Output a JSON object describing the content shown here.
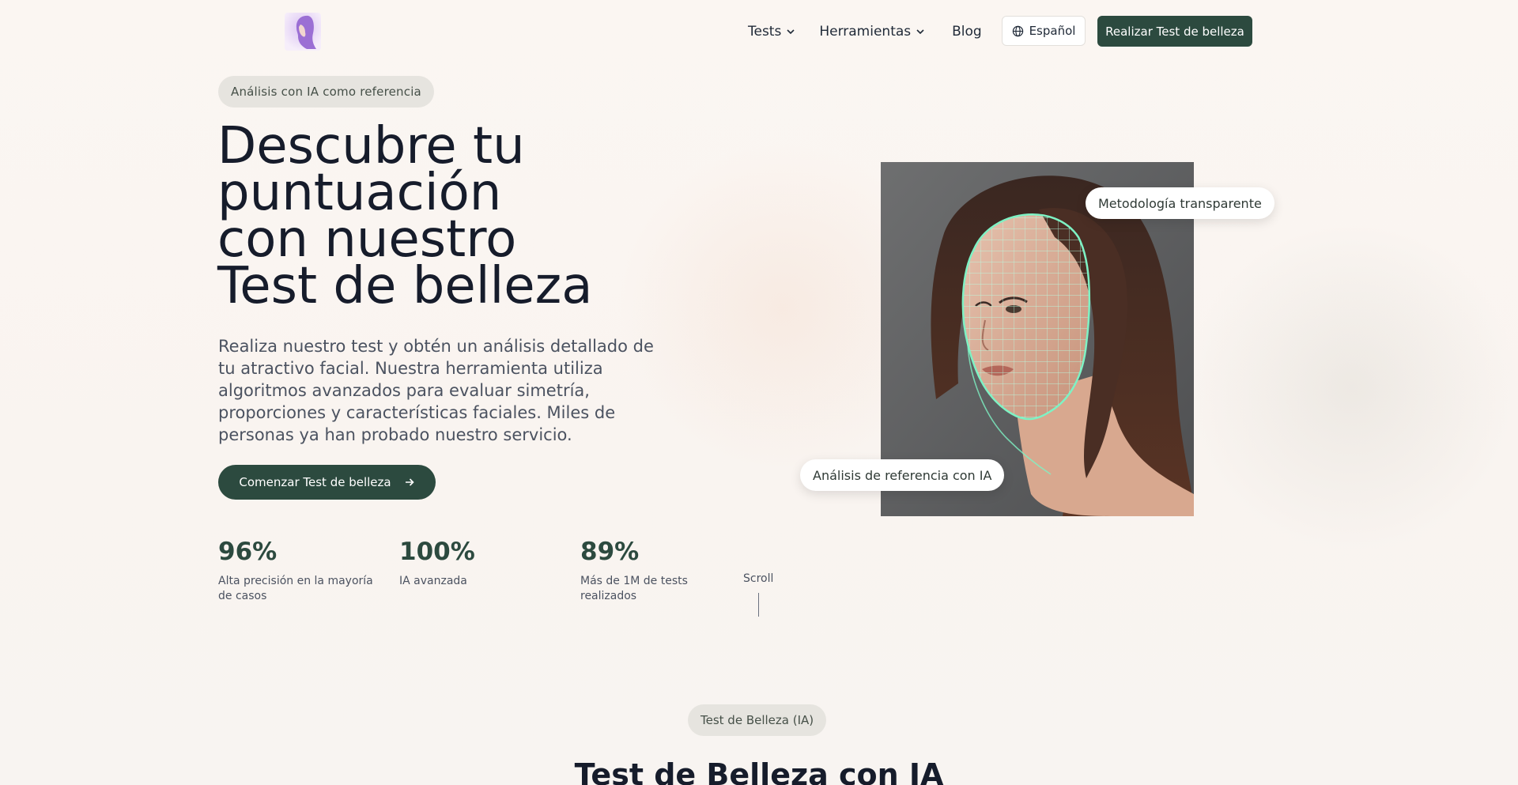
{
  "header": {
    "logo_icon": "woman-profile-logo",
    "nav": [
      {
        "label": "Tests",
        "has_dropdown": true
      },
      {
        "label": "Herramientas",
        "has_dropdown": true
      },
      {
        "label": "Blog",
        "has_dropdown": false
      }
    ],
    "language_label": "Español",
    "language_icon": "globe-icon",
    "cta_label": "Realizar Test de belleza"
  },
  "hero": {
    "badge": "Análisis con IA como referencia",
    "title_lines": [
      "Descubre tu",
      "puntuación",
      "con nuestro",
      "Test de belleza"
    ],
    "description": "Realiza nuestro test y obtén un análisis detallado de tu atractivo facial. Nuestra herramienta utiliza algoritmos avanzados para evaluar simetría, proporciones y características faciales. Miles de personas ya han probado nuestro servicio.",
    "cta_label": "Comenzar Test de belleza",
    "cta_icon": "arrow-right-icon",
    "stats": [
      {
        "value": "96%",
        "label": "Alta precisión en la mayoría de casos"
      },
      {
        "value": "100%",
        "label": "IA avanzada"
      },
      {
        "value": "89%",
        "label": "Más de 1M de tests realizados"
      }
    ],
    "scroll_label": "Scroll",
    "image_tags": {
      "top": "Metodología transparente",
      "bottom": "Análisis de referencia con IA"
    }
  },
  "section": {
    "badge": "Test de Belleza (IA)",
    "title": "Test de Belleza con IA"
  },
  "colors": {
    "accent": "#2c4a3f",
    "background": "#fbf6f2",
    "mesh": "#7ef2c4"
  }
}
